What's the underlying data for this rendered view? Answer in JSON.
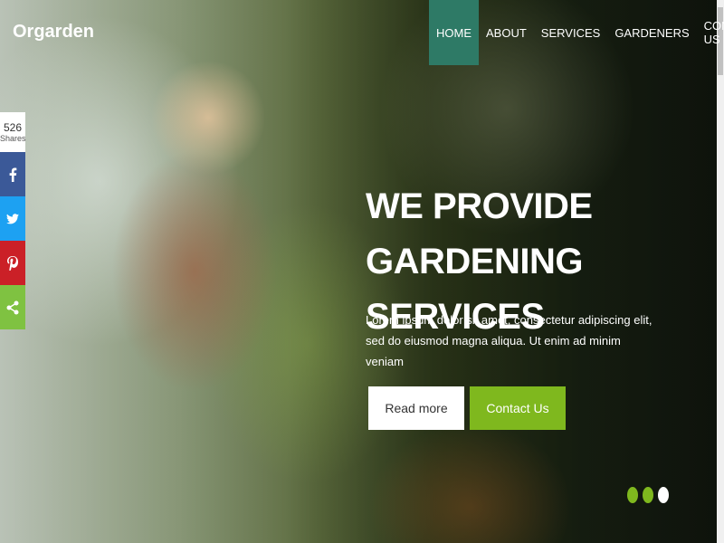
{
  "brand": {
    "name": "Orgarden"
  },
  "nav": {
    "items": [
      {
        "label": "HOME",
        "active": true
      },
      {
        "label": "ABOUT"
      },
      {
        "label": "SERVICES"
      },
      {
        "label": "GARDENERS"
      },
      {
        "label": "CONTACT US"
      }
    ]
  },
  "social": {
    "count": "526",
    "count_label": "Shares",
    "networks": [
      "facebook-icon",
      "twitter-icon",
      "pinterest-icon",
      "share-icon"
    ]
  },
  "hero": {
    "headline_line1": "WE PROVIDE",
    "headline_line2": "GARDENING SERVICES",
    "description": "Lorem ipsum dolor sit amet, consectetur adipiscing elit, sed do eiusmod magna aliqua. Ut enim ad minim veniam",
    "read_more": "Read more",
    "contact": "Contact Us"
  },
  "carousel": {
    "slides": 3,
    "active_colors": [
      "#7fb81e",
      "#7fb81e",
      "#ffffff"
    ]
  },
  "colors": {
    "accent": "#7fb81e",
    "nav_active": "#2e7a66"
  }
}
